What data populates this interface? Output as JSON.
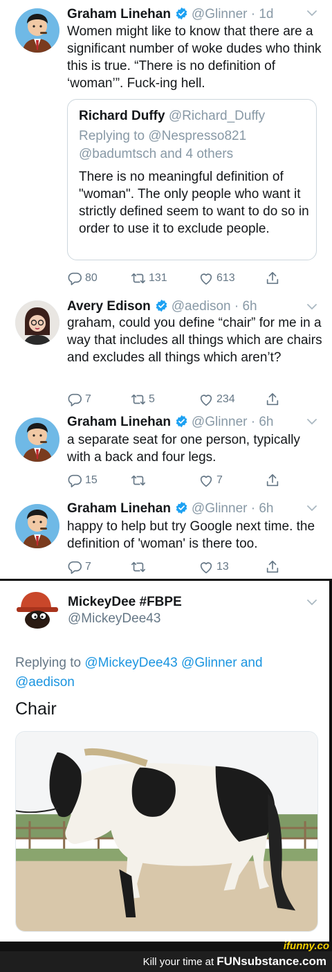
{
  "tweets": [
    {
      "name": "Graham Linehan",
      "handle": "@Glinner",
      "time": "1d",
      "text": "Women might like to know that there are a significant number of woke dudes who think this is true. “There is no definition of ‘woman’”. Fuck-ing hell.",
      "quote": {
        "name": "Richard Duffy",
        "handle": "@Richard_Duffy",
        "replying_line1": "Replying to @Nespresso821",
        "replying_line2": "@badumtsch and 4 others",
        "text": "There is no meaningful definition of \"woman\". The only people who want it strictly defined seem to want to do so in order to use it to exclude people."
      },
      "replies": "80",
      "retweets": "131",
      "likes": "613"
    },
    {
      "name": "Avery Edison",
      "handle": "@aedison",
      "time": "6h",
      "text": "graham, could you define “chair” for me in a way that includes all things which are chairs and excludes all things which aren’t?",
      "replies": "7",
      "retweets": "5",
      "likes": "234"
    },
    {
      "name": "Graham Linehan",
      "handle": "@Glinner",
      "time": "6h",
      "text": "a separate seat for one person, typically with a back and four legs.",
      "replies": "15",
      "retweets": "",
      "likes": "7"
    },
    {
      "name": "Graham Linehan",
      "handle": "@Glinner",
      "time": "6h",
      "text": "happy to help but try Google next time. the definition of 'woman' is there too.",
      "replies": "7",
      "retweets": "",
      "likes": "13"
    }
  ],
  "mickey": {
    "name": "MickeyDee #FBPE",
    "handle": "@MickeyDee43",
    "replying_prefix": "Replying to ",
    "replying_mention1": "@MickeyDee43",
    "replying_mention2": "@Glinner",
    "replying_and": " and ",
    "replying_mention3": "@aedison",
    "text": "Chair"
  },
  "footer": {
    "watermark": "ifunny.co",
    "tagline": "Kill your time at ",
    "brand": "FUNsubstance.com"
  },
  "colors": {
    "link": "#1b95e0",
    "verified": "#1da1f2",
    "muted": "#8899a6"
  },
  "icons": [
    "reply-icon",
    "retweet-icon",
    "like-icon",
    "share-icon",
    "verified-icon",
    "chevron-down-icon"
  ]
}
